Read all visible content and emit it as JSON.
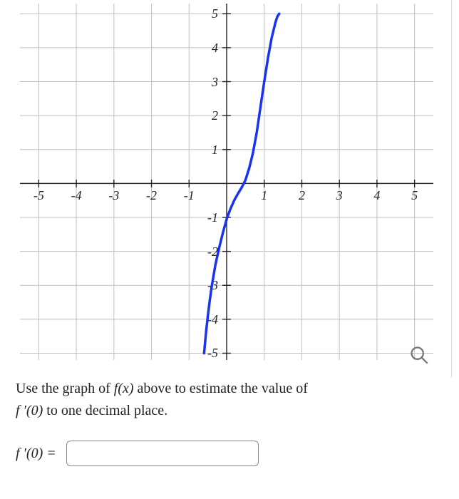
{
  "chart_data": {
    "type": "line",
    "title": "",
    "xlabel": "",
    "ylabel": "",
    "xlim": [
      -5,
      5
    ],
    "ylim": [
      -5,
      5
    ],
    "grid": true,
    "x_ticks": [
      -5,
      -4,
      -3,
      -2,
      -1,
      1,
      2,
      3,
      4,
      5
    ],
    "y_ticks": [
      -5,
      -4,
      -3,
      -2,
      -1,
      1,
      2,
      3,
      4,
      5
    ],
    "series": [
      {
        "name": "f(x)",
        "color": "#1933f2",
        "x": [
          -0.6,
          -0.55,
          -0.5,
          -0.45,
          -0.4,
          -0.3,
          -0.2,
          -0.1,
          0.0,
          0.1,
          0.2,
          0.3,
          0.4,
          0.5,
          0.6,
          0.7,
          0.8,
          0.9,
          1.0,
          1.1,
          1.2,
          1.3,
          1.35,
          1.4
        ],
        "values": [
          -5.0,
          -4.4,
          -3.9,
          -3.45,
          -3.05,
          -2.4,
          -1.9,
          -1.45,
          -1.05,
          -0.75,
          -0.5,
          -0.3,
          -0.12,
          0.1,
          0.45,
          0.9,
          1.5,
          2.25,
          3.0,
          3.7,
          4.3,
          4.75,
          4.92,
          5.0
        ]
      }
    ]
  },
  "question": {
    "line1_pre": "Use the graph of ",
    "fx": "f(x)",
    "line1_post": " above to estimate the value of",
    "fprime": "f ′(0)",
    "line2_post": " to one decimal place."
  },
  "answer": {
    "label_lhs": "f ′(0) = ",
    "value": "",
    "placeholder": ""
  },
  "icons": {
    "magnify": "magnify-icon"
  }
}
